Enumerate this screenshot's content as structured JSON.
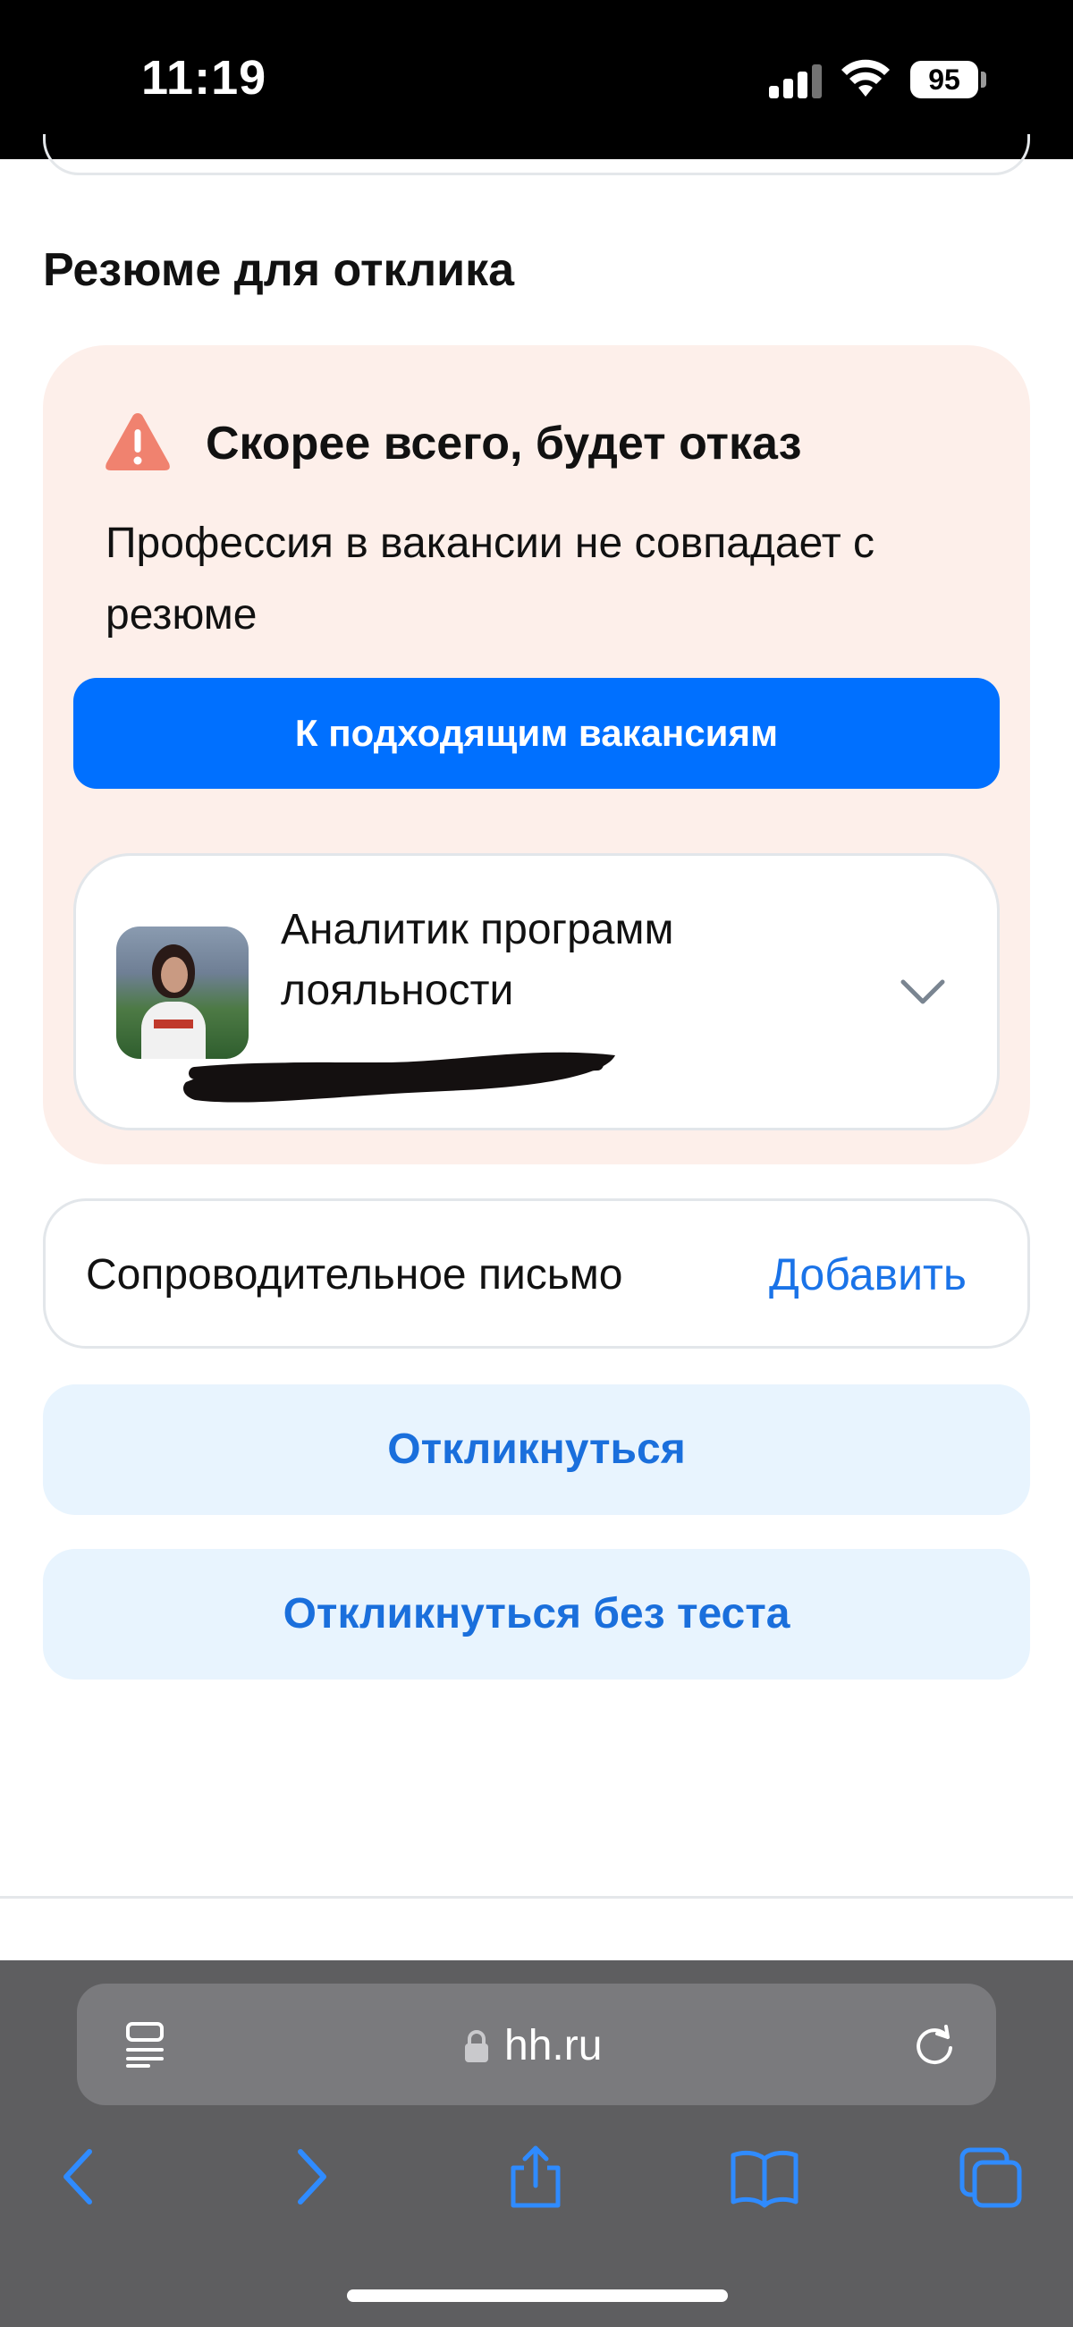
{
  "status_bar": {
    "time": "11:19",
    "battery": "95"
  },
  "resume_section": {
    "title": "Резюме для отклика",
    "warning": {
      "title": "Скорее всего, будет отказ",
      "text": "Профессия в вакансии не совпадает с резюме",
      "button_label": "К подходящим вакансиям"
    },
    "resume": {
      "title": "Аналитик программ лояльности"
    }
  },
  "cover_letter": {
    "label": "Сопроводительное письмо",
    "action": "Добавить"
  },
  "actions": {
    "respond": "Откликнуться",
    "respond_without_test": "Откликнуться без теста"
  },
  "browser": {
    "url": "hh.ru"
  },
  "colors": {
    "primary": "#0070ff",
    "link": "#1a73e8",
    "warning_bg": "#fdefea",
    "warning_icon": "#f0826f",
    "secondary_bg": "#e8f4fe"
  }
}
